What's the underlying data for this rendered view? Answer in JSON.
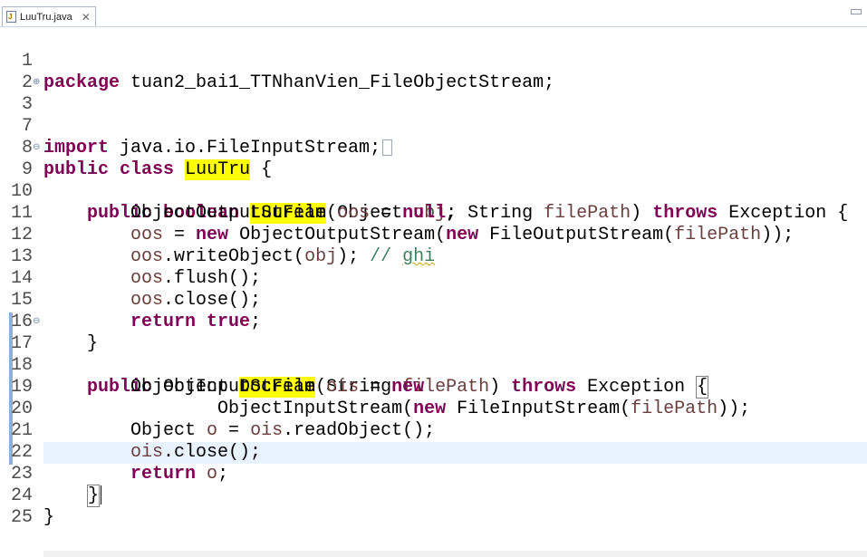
{
  "editor": {
    "tab_label": "LuuTru.java",
    "tab_icon": "java-file-icon",
    "close_glyph": "✕",
    "lines": [
      {
        "n": "1",
        "code": "package tuan2_bai1_TTNhanVien_FileObjectStream;"
      },
      {
        "n": "2",
        "code": ""
      },
      {
        "n": "3",
        "code": "import java.io.FileInputStream;"
      },
      {
        "n": "7",
        "code": ""
      },
      {
        "n": "8",
        "code": "public class LuuTru {"
      },
      {
        "n": "9",
        "code": "    public boolean LuuFile(Object obj, String filePath) throws Exception {"
      },
      {
        "n": "10",
        "code": "        ObjectOutputStream oos = null;"
      },
      {
        "n": "11",
        "code": "        oos = new ObjectOutputStream(new FileOutputStream(filePath));"
      },
      {
        "n": "12",
        "code": "        oos.writeObject(obj); // ghi"
      },
      {
        "n": "13",
        "code": "        oos.flush();"
      },
      {
        "n": "14",
        "code": "        oos.close();"
      },
      {
        "n": "15",
        "code": "        return true;"
      },
      {
        "n": "16",
        "code": "    }"
      },
      {
        "n": "17",
        "code": "    public Object DocFile(String filePath) throws Exception {"
      },
      {
        "n": "18",
        "code": "        ObjectInputStream ois = new"
      },
      {
        "n": "19",
        "code": "                ObjectInputStream(new FileInputStream(filePath));"
      },
      {
        "n": "20",
        "code": "        Object o = ois.readObject();"
      },
      {
        "n": "21",
        "code": "        ois.close();"
      },
      {
        "n": "22",
        "code": "        return o;"
      },
      {
        "n": "23",
        "code": "    }"
      },
      {
        "n": "24",
        "code": "}"
      },
      {
        "n": "25",
        "code": ""
      }
    ],
    "fold_markers": {
      "expand": "⊕",
      "collapse": "⊖"
    },
    "colors": {
      "keyword": "#7f0055",
      "field": "#6a3e3e",
      "comment": "#3f7f5f",
      "highlight": "#ffff00",
      "current_line": "#e8f2fe"
    }
  }
}
